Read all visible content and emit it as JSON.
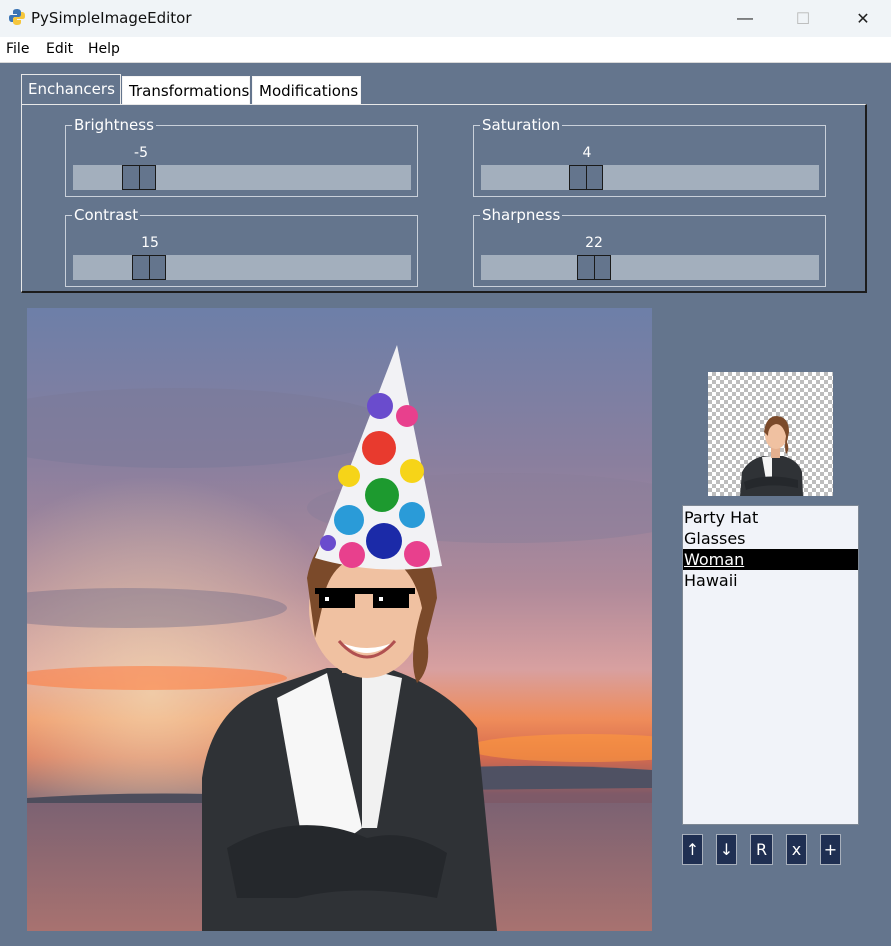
{
  "window": {
    "title": "PySimpleImageEditor",
    "minimize_icon": "minimize-icon",
    "maximize_icon": "maximize-icon",
    "close_icon": "close-icon",
    "minimize_glyph": "—",
    "maximize_glyph": "☐",
    "close_glyph": "✕"
  },
  "menu": {
    "items": [
      "File",
      "Edit",
      "Help"
    ]
  },
  "tabs": [
    {
      "label": "Enchancers",
      "active": true
    },
    {
      "label": "Transformations",
      "active": false
    },
    {
      "label": "Modifications",
      "active": false
    }
  ],
  "sliders": {
    "brightness": {
      "label": "Brightness",
      "value": "-5"
    },
    "saturation": {
      "label": "Saturation",
      "value": "4"
    },
    "contrast": {
      "label": "Contrast",
      "value": "15"
    },
    "sharpness": {
      "label": "Sharpness",
      "value": "22"
    }
  },
  "layers": {
    "items": [
      "Party Hat",
      "Glasses",
      "Woman",
      "Hawaii"
    ],
    "selected": "Woman"
  },
  "buttons": {
    "up": "↑",
    "down": "↓",
    "reset": "R",
    "delete": "x",
    "add": "+"
  },
  "colors": {
    "background": "#64758d",
    "trough": "#a3afbd",
    "button": "#1f2f52",
    "listbox": "#f1f3f9"
  }
}
